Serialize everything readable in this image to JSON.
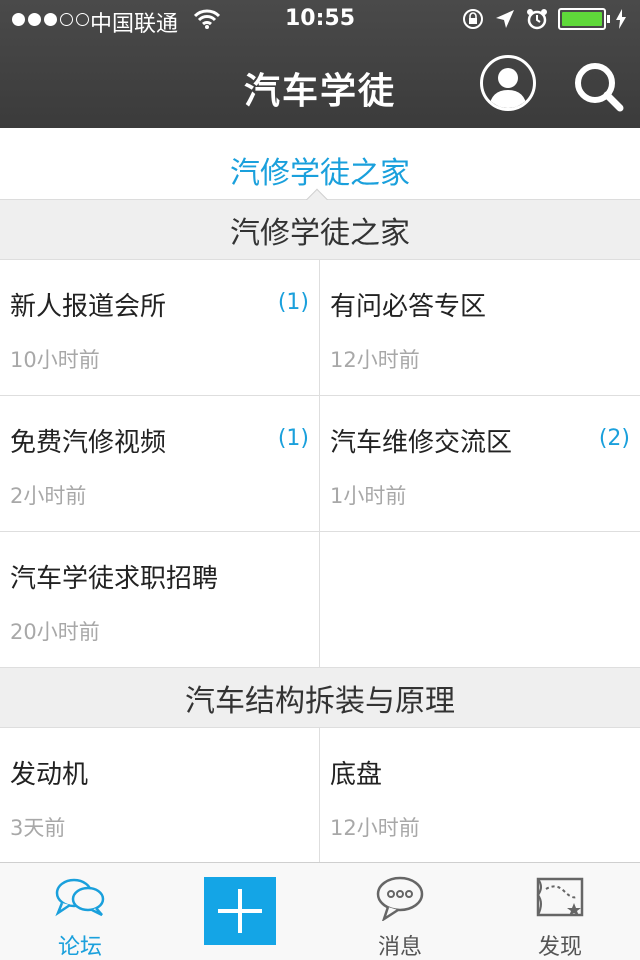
{
  "status_bar": {
    "carrier": "中国联通",
    "time": "10:55"
  },
  "nav": {
    "title": "汽车学徒",
    "icons": [
      "user-icon",
      "search-icon"
    ]
  },
  "subtab": {
    "label": "汽修学徒之家"
  },
  "sections": [
    {
      "title": "汽修学徒之家",
      "items": [
        {
          "name": "新人报道会所",
          "count": "(1)",
          "ago": "10小时前"
        },
        {
          "name": "有问必答专区",
          "count": "",
          "ago": "12小时前"
        },
        {
          "name": "免费汽修视频",
          "count": "(1)",
          "ago": "2小时前"
        },
        {
          "name": "汽车维修交流区",
          "count": "(2)",
          "ago": "1小时前"
        },
        {
          "name": "汽车学徒求职招聘",
          "count": "",
          "ago": "20小时前"
        }
      ]
    },
    {
      "title": "汽车结构拆装与原理",
      "items": [
        {
          "name": "发动机",
          "count": "",
          "ago": "3天前"
        },
        {
          "name": "底盘",
          "count": "",
          "ago": "12小时前"
        }
      ]
    }
  ],
  "tabbar": {
    "tabs": [
      {
        "label": "论坛",
        "icon": "chat-bubbles-icon",
        "active": true
      },
      {
        "label": "",
        "icon": "plus-icon",
        "active": false
      },
      {
        "label": "消息",
        "icon": "message-icon",
        "active": false
      },
      {
        "label": "发现",
        "icon": "map-icon",
        "active": false
      }
    ]
  },
  "colors": {
    "accent": "#1aa0dc",
    "nav_bg": "#3f3f3f",
    "section_bg": "#efefef"
  }
}
